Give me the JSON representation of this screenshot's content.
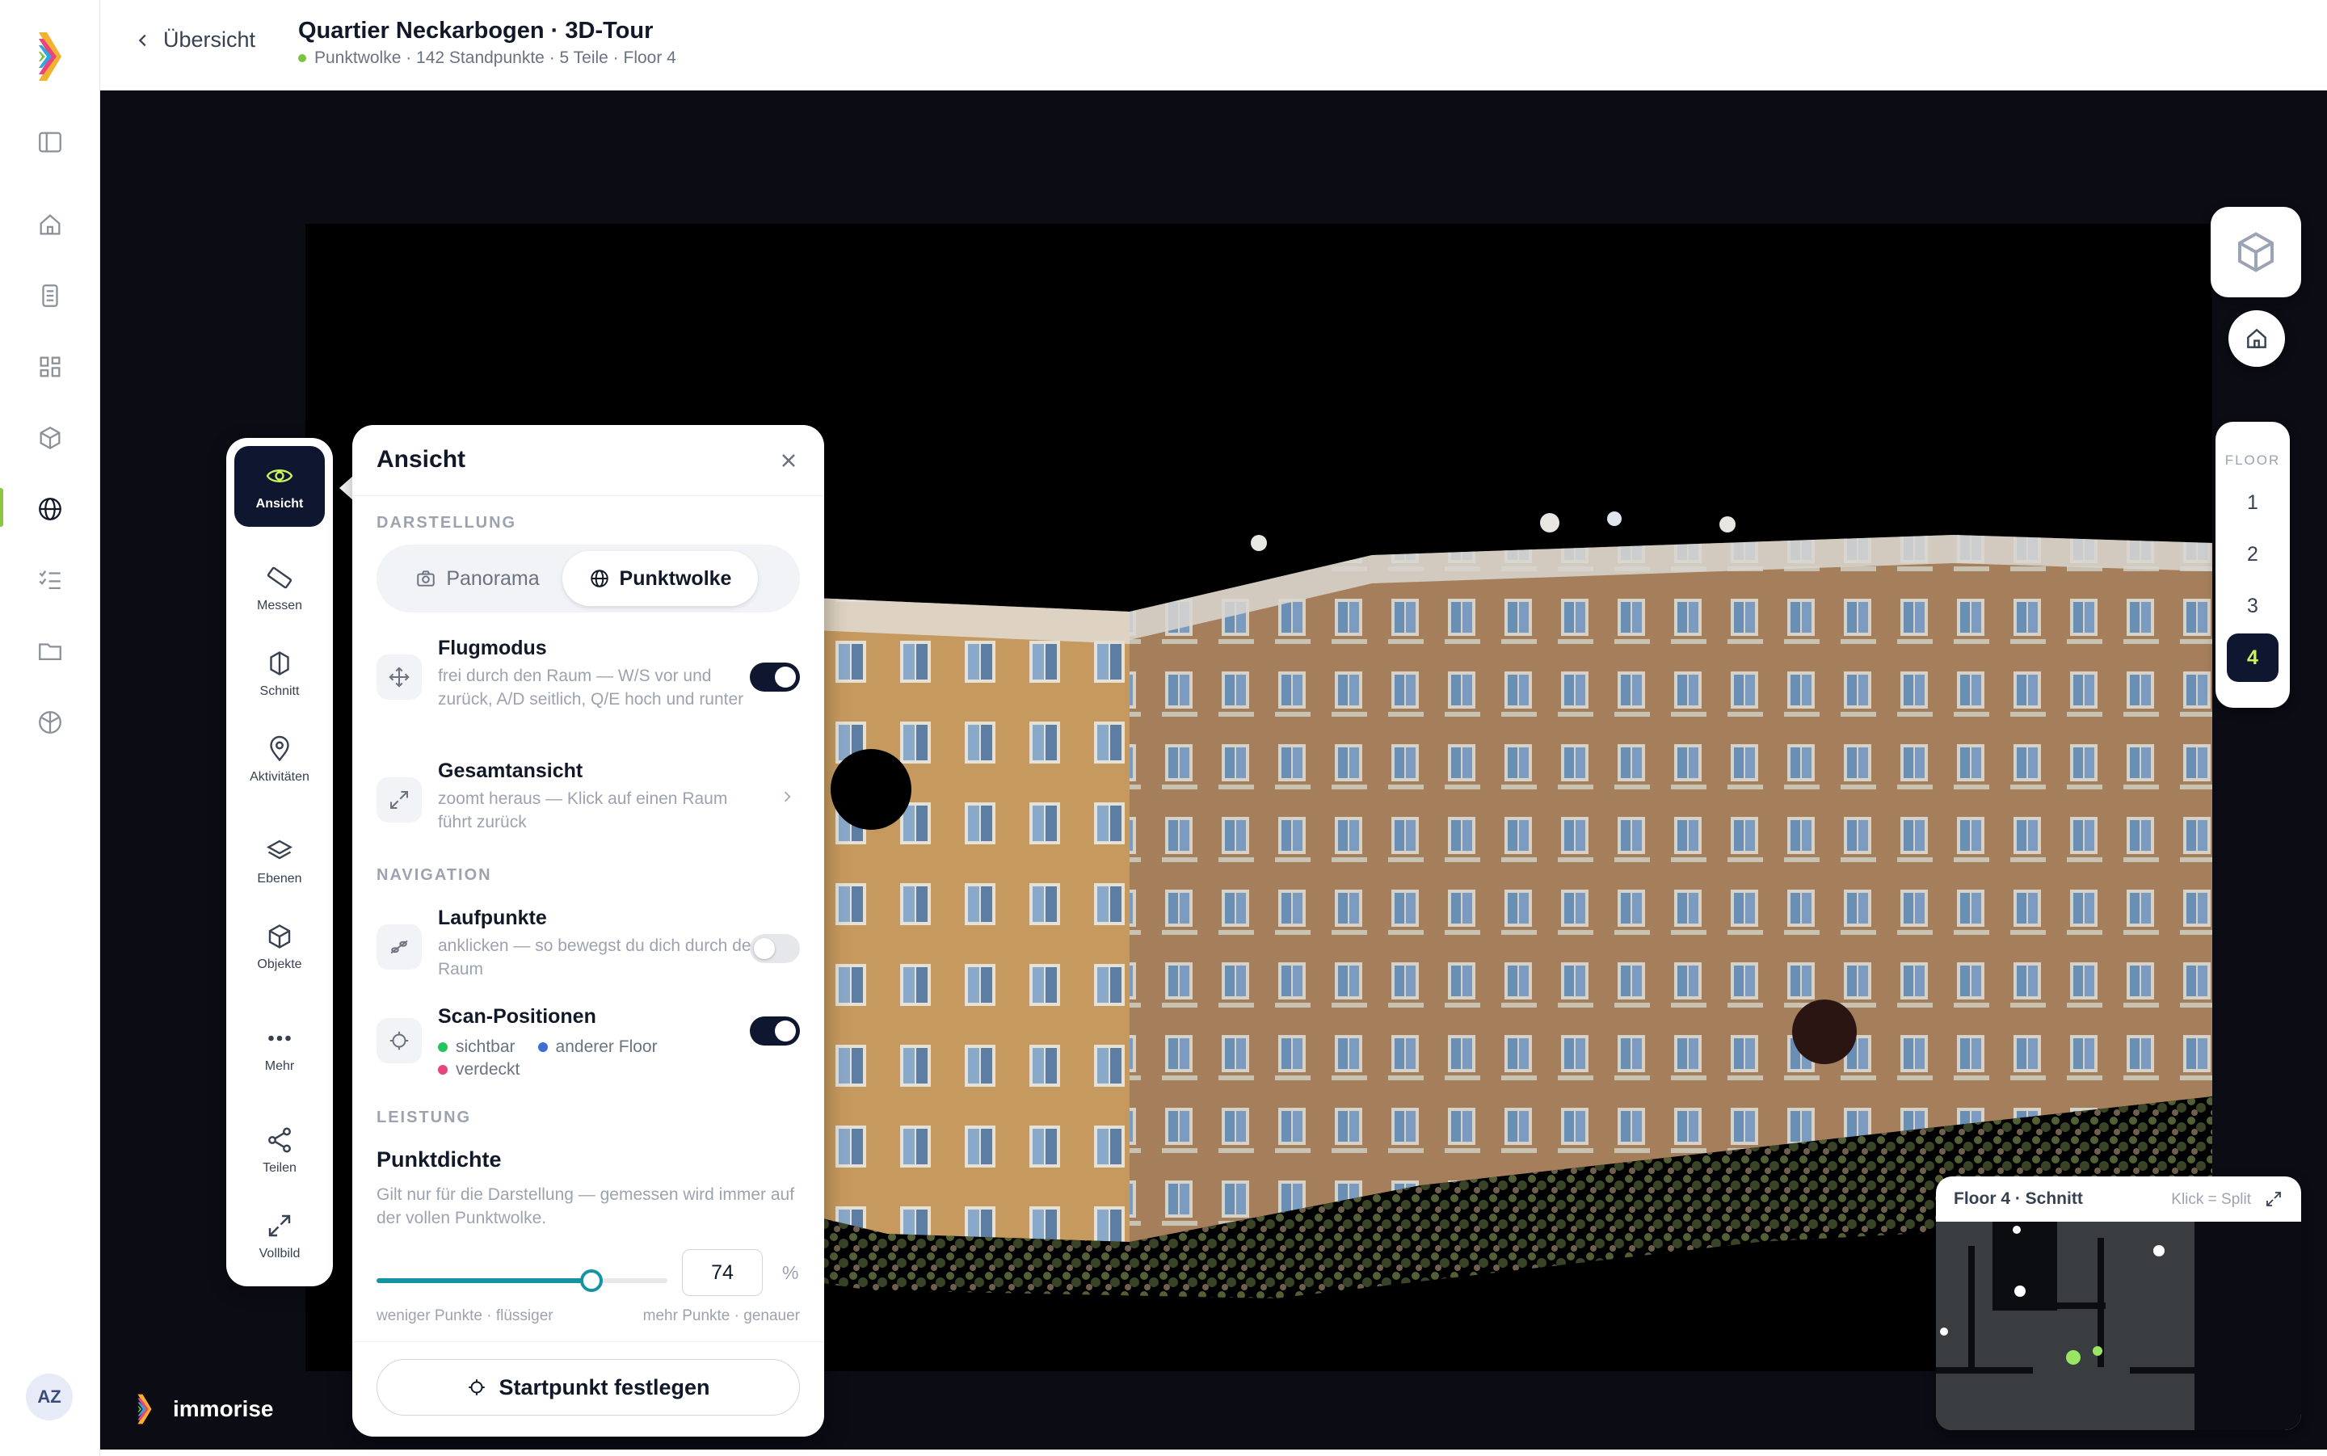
{
  "header": {
    "back_label": "Übersicht",
    "title": "Quartier Neckarbogen · 3D-Tour",
    "subtitle": "Punktwolke · 142 Standpunkte · 5 Teile · Floor 4",
    "status_color": "#7cc242"
  },
  "rail": {
    "items": [
      "sidebar-toggle-icon",
      "home-icon",
      "document-icon",
      "grid-icon",
      "cube-icon",
      "globe-icon",
      "checklist-icon",
      "folder-icon",
      "compass-icon"
    ],
    "active": "globe-icon",
    "avatar": "AZ"
  },
  "tools": [
    {
      "label": "Ansicht",
      "icon": "eye-icon",
      "active": true
    },
    {
      "label": "Messen",
      "icon": "ruler-icon"
    },
    {
      "label": "Schnitt",
      "icon": "section-icon"
    },
    {
      "label": "Aktivitäten",
      "icon": "pin-icon"
    },
    {
      "label": "Ebenen",
      "icon": "layers-icon"
    },
    {
      "label": "Objekte",
      "icon": "box-icon"
    },
    {
      "label": "Mehr",
      "icon": "more-icon"
    },
    {
      "label": "Teilen",
      "icon": "share-icon"
    },
    {
      "label": "Vollbild",
      "icon": "fullscreen-icon"
    }
  ],
  "panel": {
    "title": "Ansicht",
    "section_display": "DARSTELLUNG",
    "seg_panorama": "Panorama",
    "seg_pointcloud": "Punktwolke",
    "seg_selected": "Punktwolke",
    "flight": {
      "title": "Flugmodus",
      "desc": "frei durch den Raum — W/S vor und zurück, A/D seitlich, Q/E hoch und runter",
      "on": true
    },
    "overview": {
      "title": "Gesamtansicht",
      "desc": "zoomt heraus — Klick auf einen Raum führt zurück"
    },
    "section_nav": "NAVIGATION",
    "walk": {
      "title": "Laufpunkte",
      "desc": "anklicken — so bewegst du dich durch den Raum",
      "on": false
    },
    "scan": {
      "title": "Scan-Positionen",
      "on": true,
      "legend": [
        {
          "label": "sichtbar",
          "color": "#22c55e"
        },
        {
          "label": "anderer Floor",
          "color": "#3b6fd8"
        },
        {
          "label": "verdeckt",
          "color": "#e8457e"
        }
      ]
    },
    "section_perf": "LEISTUNG",
    "density": {
      "title": "Punktdichte",
      "desc": "Gilt nur für die Darstellung — gemessen wird immer auf der vollen Punktwolke.",
      "value": "74",
      "fraction": 0.74,
      "unit": "%",
      "min_label": "weniger Punkte · flüssiger",
      "max_label": "mehr Punkte · genauer"
    },
    "start_button": "Startpunkt festlegen"
  },
  "floors": {
    "label": "FLOOR",
    "items": [
      "1",
      "2",
      "3",
      "4"
    ],
    "selected": "4"
  },
  "minimap": {
    "title": "Floor 4 · Schnitt",
    "hint": "Klick = Split"
  },
  "brand": {
    "name": "immorise"
  },
  "colors": {
    "accent": "#c9f35a",
    "dark": "#0f1730",
    "slider": "#1592a4"
  }
}
